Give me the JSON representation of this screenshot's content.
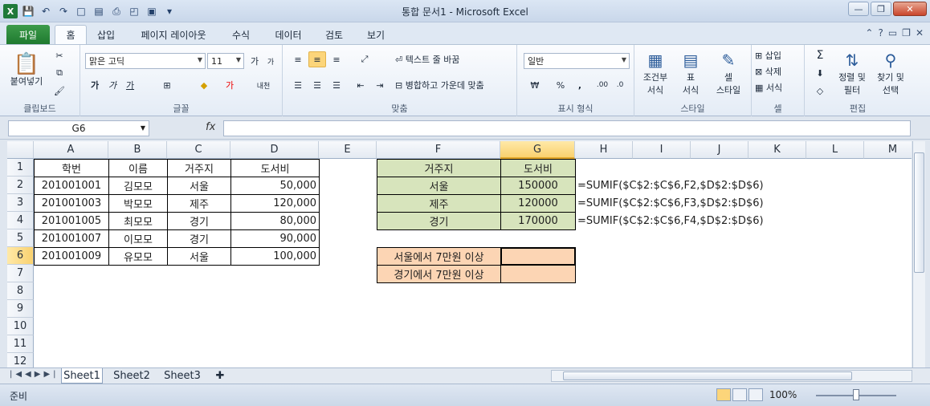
{
  "window": {
    "title": "통합 문서1  -  Microsoft Excel"
  },
  "tabs": [
    "파일",
    "홈",
    "삽입",
    "페이지 레이아웃",
    "수식",
    "데이터",
    "검토",
    "보기"
  ],
  "ribbon": {
    "clipboard": {
      "label": "클립보드",
      "paste": "붙여넣기"
    },
    "font": {
      "label": "글꼴",
      "name": "맑은 고딕",
      "size": "11",
      "bold": "가",
      "italic": "가",
      "underline": "가"
    },
    "align": {
      "label": "맞춤",
      "wrap": "텍스트 줄 바꿈",
      "merge": "병합하고 가운데 맞춤"
    },
    "number": {
      "label": "표시 형식",
      "format": "일반",
      "percent": "%",
      "comma": ","
    },
    "styles": {
      "label": "스타일",
      "cond1": "조건부",
      "cond2": "서식",
      "table1": "표",
      "table2": "서식",
      "cell1": "셀",
      "cell2": "스타일"
    },
    "cells": {
      "label": "셀",
      "insert": "삽입",
      "delete": "삭제",
      "format": "서식"
    },
    "edit": {
      "label": "편집",
      "sort1": "정렬 및",
      "sort2": "필터",
      "find1": "찾기 및",
      "find2": "선택"
    }
  },
  "formula_bar": {
    "name_box": "G6",
    "fx": "fx",
    "formula": ""
  },
  "columns": [
    "A",
    "B",
    "C",
    "D",
    "E",
    "F",
    "G",
    "H",
    "I",
    "J",
    "K",
    "L",
    "M"
  ],
  "rows": [
    "1",
    "2",
    "3",
    "4",
    "5",
    "6",
    "7",
    "8",
    "9",
    "10",
    "11",
    "12"
  ],
  "table": {
    "headers": [
      "학번",
      "이름",
      "거주지",
      "도서비"
    ],
    "rows": [
      [
        "201001001",
        "김모모",
        "서울",
        "50,000"
      ],
      [
        "201001003",
        "박모모",
        "제주",
        "120,000"
      ],
      [
        "201001005",
        "최모모",
        "경기",
        "80,000"
      ],
      [
        "201001007",
        "이모모",
        "경기",
        "90,000"
      ],
      [
        "201001009",
        "유모모",
        "서울",
        "100,000"
      ]
    ]
  },
  "summary": {
    "headers": [
      "거주지",
      "도서비"
    ],
    "rows": [
      [
        "서울",
        "150000",
        "=SUMIF($C$2:$C$6,F2,$D$2:$D$6)"
      ],
      [
        "제주",
        "120000",
        "=SUMIF($C$2:$C$6,F3,$D$2:$D$6)"
      ],
      [
        "경기",
        "170000",
        "=SUMIF($C$2:$C$6,F4,$D$2:$D$6)"
      ]
    ],
    "conditions": [
      "서울에서 7만원 이상",
      "경기에서 7만원 이상"
    ]
  },
  "sheets": [
    "Sheet1",
    "Sheet2",
    "Sheet3"
  ],
  "status": {
    "mode": "준비",
    "zoom": "100%"
  }
}
